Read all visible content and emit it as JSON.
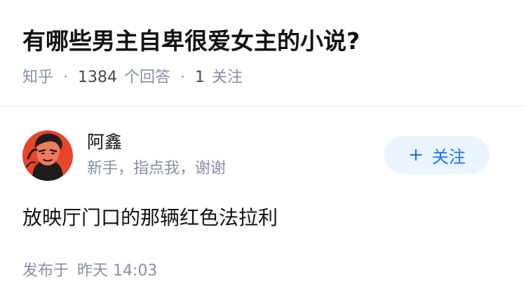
{
  "question": {
    "title": "有哪些男主自卑很爱女主的小说?",
    "source": "知乎",
    "separator": "·",
    "answer_count": "1384",
    "answer_label": "个回答",
    "follow_count": "1",
    "follow_label": "关注"
  },
  "answer": {
    "author_name": "阿鑫",
    "author_bio": "新手，指点我，谢谢",
    "follow_button_plus": "+",
    "follow_button_label": "关注",
    "content": "放映厅门口的那辆红色法拉利",
    "published_label": "发布于",
    "published_time": "昨天 14:03"
  },
  "icons": {
    "avatar": "avatar-illustration",
    "follow": "plus-icon"
  },
  "colors": {
    "accent": "#1772f6",
    "accent_bg": "#ebf5ff",
    "muted": "#8590a6",
    "avatar_bg": "#e8452a"
  }
}
